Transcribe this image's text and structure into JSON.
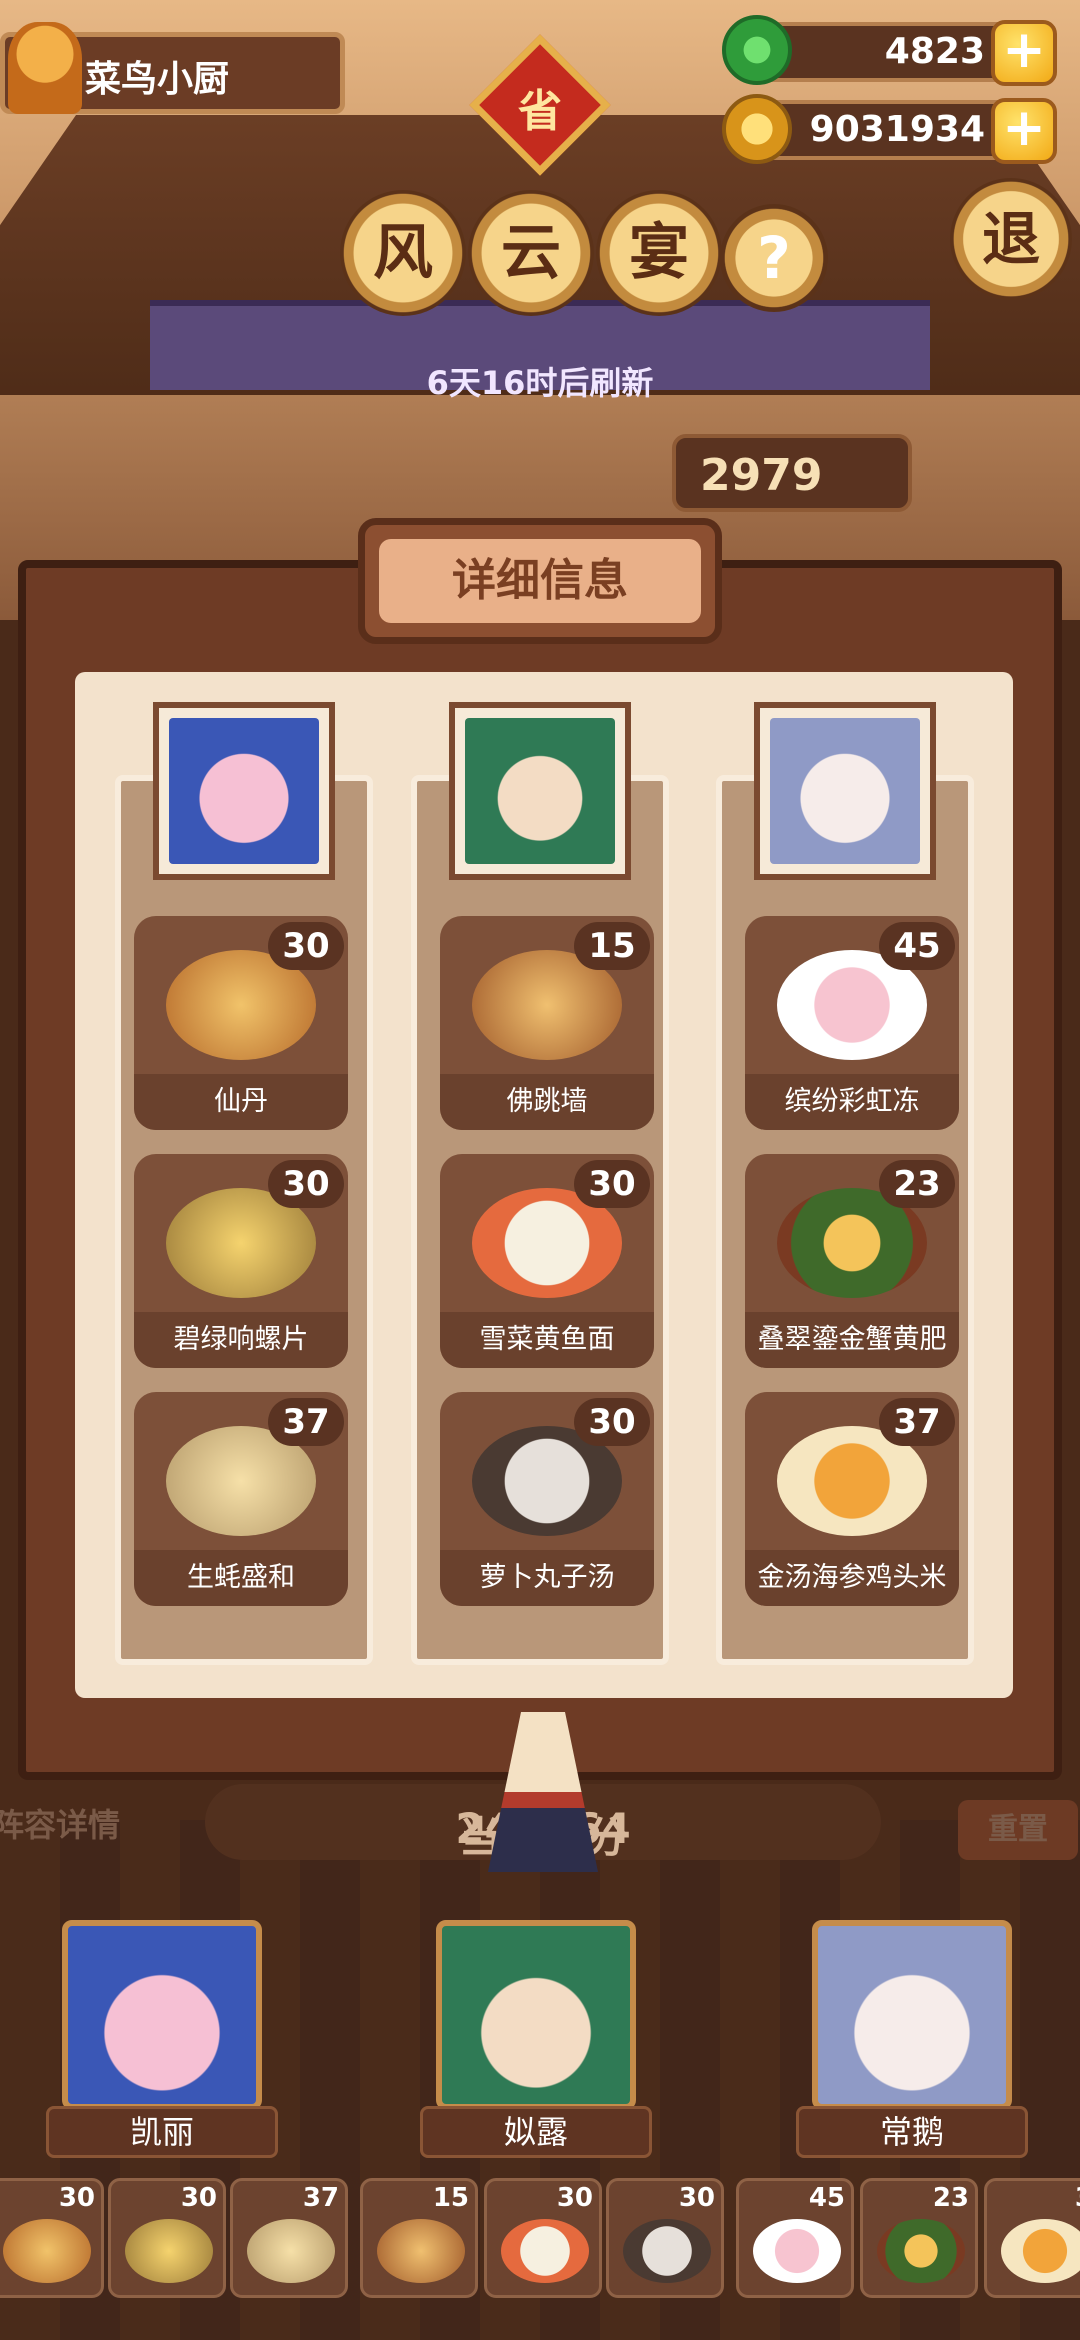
{
  "player": {
    "name": "菜鸟小厨"
  },
  "resources": {
    "jade": "4823",
    "coins": "9031934",
    "plus_symbol": "+"
  },
  "event": {
    "badge": "省",
    "title_chars": [
      "风",
      "云",
      "宴"
    ],
    "help_symbol": "?",
    "exit_label": "退",
    "refresh_text": "6天16时后刷新",
    "score_partial": "2979"
  },
  "panel": {
    "header": "详细信息",
    "columns": [
      {
        "character": "凯丽",
        "portrait_colors": [
          "#f6c0d4",
          "#3a57b6"
        ],
        "dishes": [
          {
            "name": "仙丹",
            "value": "30",
            "color": "#d9a24a"
          },
          {
            "name": "碧绿响螺片",
            "value": "30",
            "color": "#e0a64f"
          },
          {
            "name": "生蚝盛和",
            "value": "37",
            "color": "#d8b270"
          }
        ]
      },
      {
        "character": "姒露",
        "portrait_colors": [
          "#7fcf9a",
          "#2f7a55"
        ],
        "dishes": [
          {
            "name": "佛跳墙",
            "value": "15",
            "color": "#c97a3a"
          },
          {
            "name": "雪菜黄鱼面",
            "value": "30",
            "color": "#e56a3e"
          },
          {
            "name": "萝卜丸子汤",
            "value": "30",
            "color": "#9b7a6a"
          }
        ]
      },
      {
        "character": "常鹅",
        "portrait_colors": [
          "#e6ecf6",
          "#8f9ac6"
        ],
        "dishes": [
          {
            "name": "缤纷彩虹冻",
            "value": "45",
            "color": "#f5cfd6"
          },
          {
            "name": "叠翠鎏金蟹黄肥",
            "value": "23",
            "color": "#5f8a3a"
          },
          {
            "name": "金汤海参鸡头米",
            "value": "37",
            "color": "#e8a24a"
          }
        ]
      }
    ]
  },
  "bottom": {
    "lineup_label": "阵容详情",
    "score_label": "当前得分",
    "score_value": "244564",
    "reset_label": "重置",
    "characters": [
      "凯丽",
      "姒露",
      "常鹅"
    ],
    "slots": [
      {
        "value": "30",
        "color": "#d9a24a"
      },
      {
        "value": "30",
        "color": "#e0a64f"
      },
      {
        "value": "37",
        "color": "#d8b270"
      },
      {
        "value": "15",
        "color": "#c97a3a"
      },
      {
        "value": "30",
        "color": "#e56a3e"
      },
      {
        "value": "30",
        "color": "#9b7a6a"
      },
      {
        "value": "45",
        "color": "#f5cfd6"
      },
      {
        "value": "23",
        "color": "#5f8a3a"
      },
      {
        "value": "3",
        "color": "#e8a24a"
      }
    ]
  }
}
